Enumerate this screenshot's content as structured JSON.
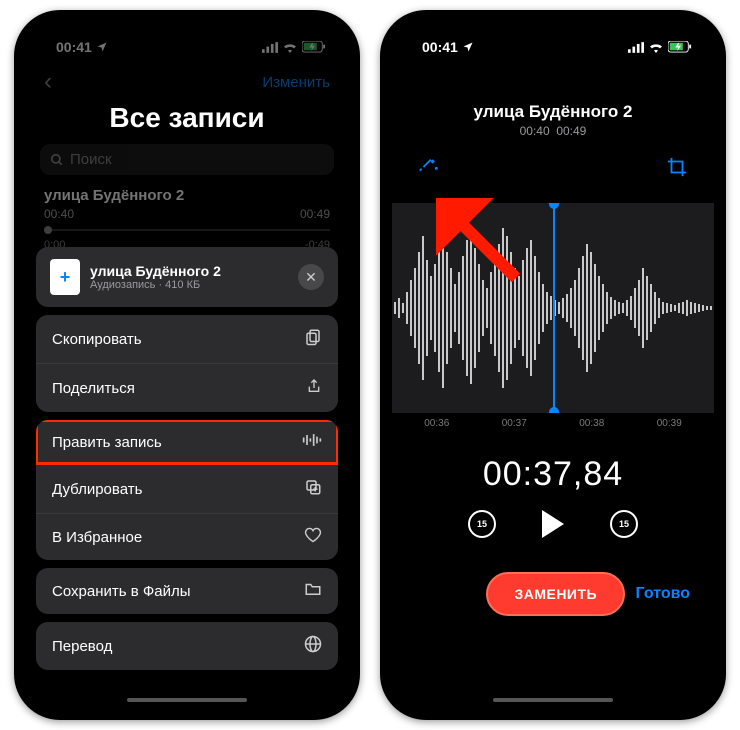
{
  "status": {
    "time": "00:41",
    "loc_icon": "location-arrow"
  },
  "left": {
    "edit_link": "Изменить",
    "title": "Все записи",
    "search_placeholder": "Поиск",
    "recording": {
      "name": "улица Будённого 2",
      "pos": "00:40",
      "dur": "00:49",
      "elapsed": "0:00",
      "remain": "-0:49"
    },
    "sheet": {
      "file_name": "улица Будённого 2",
      "file_meta": "Аудиозапись · 410 КБ",
      "items_a": [
        {
          "label": "Скопировать",
          "icon": "copy"
        },
        {
          "label": "Поделиться",
          "icon": "share"
        }
      ],
      "items_b": [
        {
          "label": "Править запись",
          "icon": "waveform",
          "hl": true
        },
        {
          "label": "Дублировать",
          "icon": "duplicate"
        },
        {
          "label": "В Избранное",
          "icon": "heart"
        }
      ],
      "items_c": [
        {
          "label": "Сохранить в Файлы",
          "icon": "folder"
        }
      ],
      "items_d": [
        {
          "label": "Перевод",
          "icon": "globe"
        }
      ]
    }
  },
  "right": {
    "title": "улица Будённого 2",
    "pos": "00:40",
    "dur": "00:49",
    "ticks": [
      "00:36",
      "00:37",
      "00:38",
      "00:39"
    ],
    "big_time": "00:37,84",
    "skip": "15",
    "replace": "ЗАМЕНИТЬ",
    "done": "Готово"
  }
}
